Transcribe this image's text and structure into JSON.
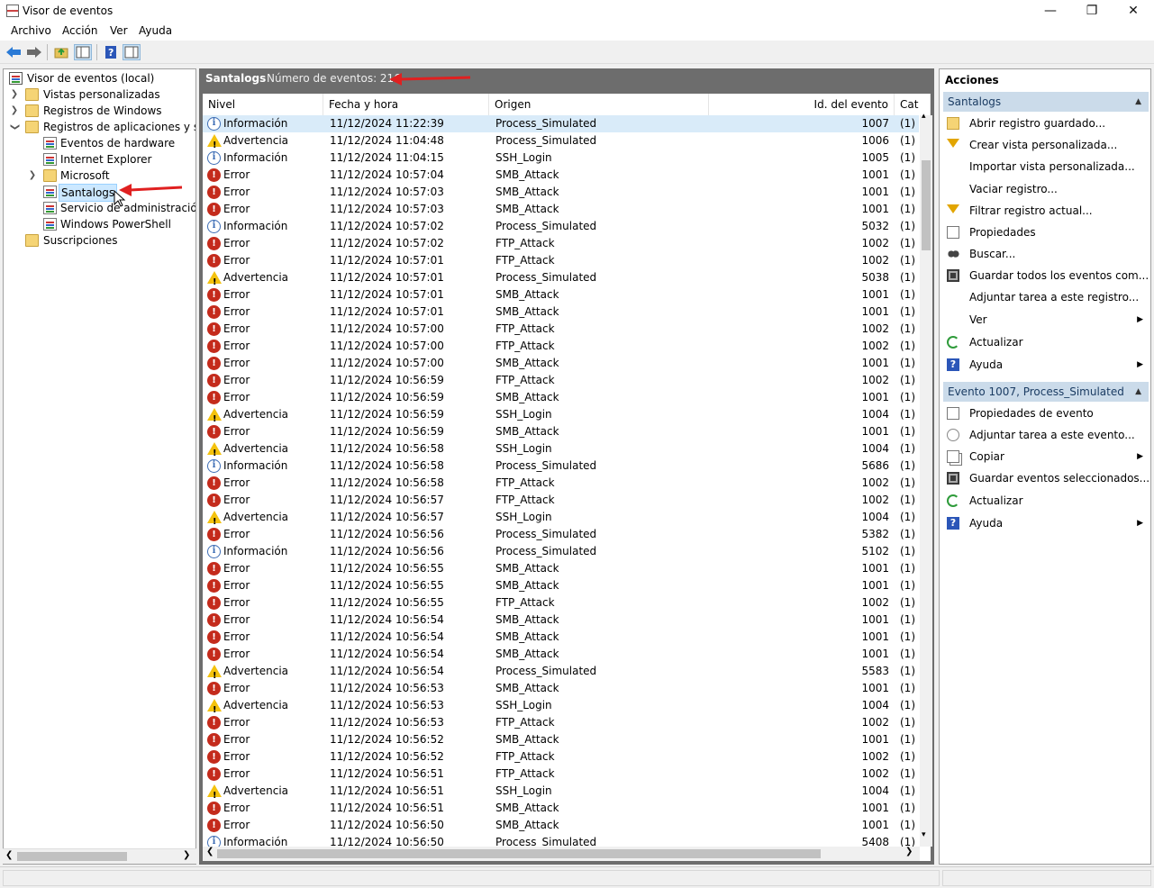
{
  "window": {
    "title": "Visor de eventos",
    "minimize": "—",
    "maximize": "❐",
    "close": "✕"
  },
  "menu": [
    "Archivo",
    "Acción",
    "Ver",
    "Ayuda"
  ],
  "tree": {
    "root": "Visor de eventos (local)",
    "custom_views": "Vistas personalizadas",
    "windows_logs": "Registros de Windows",
    "app_logs": "Registros de aplicaciones y servi",
    "hardware": "Eventos de hardware",
    "ie": "Internet Explorer",
    "microsoft": "Microsoft",
    "santalogs": "Santalogs",
    "admin_service": "Servicio de administración d",
    "powershell": "Windows PowerShell",
    "subscriptions": "Suscripciones"
  },
  "center": {
    "log_name": "Santalogs",
    "event_count": "Número de eventos: 216",
    "columns": [
      "Nivel",
      "Fecha y hora",
      "Origen",
      "Id. del evento",
      "Cat"
    ],
    "rows": [
      {
        "level": "Información",
        "type": "info",
        "date": "11/12/2024 11:22:39",
        "source": "Process_Simulated",
        "id": "1007",
        "cat": "(1)"
      },
      {
        "level": "Advertencia",
        "type": "warn",
        "date": "11/12/2024 11:04:48",
        "source": "Process_Simulated",
        "id": "1006",
        "cat": "(1)"
      },
      {
        "level": "Información",
        "type": "info",
        "date": "11/12/2024 11:04:15",
        "source": "SSH_Login",
        "id": "1005",
        "cat": "(1)"
      },
      {
        "level": "Error",
        "type": "err",
        "date": "11/12/2024 10:57:04",
        "source": "SMB_Attack",
        "id": "1001",
        "cat": "(1)"
      },
      {
        "level": "Error",
        "type": "err",
        "date": "11/12/2024 10:57:03",
        "source": "SMB_Attack",
        "id": "1001",
        "cat": "(1)"
      },
      {
        "level": "Error",
        "type": "err",
        "date": "11/12/2024 10:57:03",
        "source": "SMB_Attack",
        "id": "1001",
        "cat": "(1)"
      },
      {
        "level": "Información",
        "type": "info",
        "date": "11/12/2024 10:57:02",
        "source": "Process_Simulated",
        "id": "5032",
        "cat": "(1)"
      },
      {
        "level": "Error",
        "type": "err",
        "date": "11/12/2024 10:57:02",
        "source": "FTP_Attack",
        "id": "1002",
        "cat": "(1)"
      },
      {
        "level": "Error",
        "type": "err",
        "date": "11/12/2024 10:57:01",
        "source": "FTP_Attack",
        "id": "1002",
        "cat": "(1)"
      },
      {
        "level": "Advertencia",
        "type": "warn",
        "date": "11/12/2024 10:57:01",
        "source": "Process_Simulated",
        "id": "5038",
        "cat": "(1)"
      },
      {
        "level": "Error",
        "type": "err",
        "date": "11/12/2024 10:57:01",
        "source": "SMB_Attack",
        "id": "1001",
        "cat": "(1)"
      },
      {
        "level": "Error",
        "type": "err",
        "date": "11/12/2024 10:57:01",
        "source": "SMB_Attack",
        "id": "1001",
        "cat": "(1)"
      },
      {
        "level": "Error",
        "type": "err",
        "date": "11/12/2024 10:57:00",
        "source": "FTP_Attack",
        "id": "1002",
        "cat": "(1)"
      },
      {
        "level": "Error",
        "type": "err",
        "date": "11/12/2024 10:57:00",
        "source": "FTP_Attack",
        "id": "1002",
        "cat": "(1)"
      },
      {
        "level": "Error",
        "type": "err",
        "date": "11/12/2024 10:57:00",
        "source": "SMB_Attack",
        "id": "1001",
        "cat": "(1)"
      },
      {
        "level": "Error",
        "type": "err",
        "date": "11/12/2024 10:56:59",
        "source": "FTP_Attack",
        "id": "1002",
        "cat": "(1)"
      },
      {
        "level": "Error",
        "type": "err",
        "date": "11/12/2024 10:56:59",
        "source": "SMB_Attack",
        "id": "1001",
        "cat": "(1)"
      },
      {
        "level": "Advertencia",
        "type": "warn",
        "date": "11/12/2024 10:56:59",
        "source": "SSH_Login",
        "id": "1004",
        "cat": "(1)"
      },
      {
        "level": "Error",
        "type": "err",
        "date": "11/12/2024 10:56:59",
        "source": "SMB_Attack",
        "id": "1001",
        "cat": "(1)"
      },
      {
        "level": "Advertencia",
        "type": "warn",
        "date": "11/12/2024 10:56:58",
        "source": "SSH_Login",
        "id": "1004",
        "cat": "(1)"
      },
      {
        "level": "Información",
        "type": "info",
        "date": "11/12/2024 10:56:58",
        "source": "Process_Simulated",
        "id": "5686",
        "cat": "(1)"
      },
      {
        "level": "Error",
        "type": "err",
        "date": "11/12/2024 10:56:58",
        "source": "FTP_Attack",
        "id": "1002",
        "cat": "(1)"
      },
      {
        "level": "Error",
        "type": "err",
        "date": "11/12/2024 10:56:57",
        "source": "FTP_Attack",
        "id": "1002",
        "cat": "(1)"
      },
      {
        "level": "Advertencia",
        "type": "warn",
        "date": "11/12/2024 10:56:57",
        "source": "SSH_Login",
        "id": "1004",
        "cat": "(1)"
      },
      {
        "level": "Error",
        "type": "err",
        "date": "11/12/2024 10:56:56",
        "source": "Process_Simulated",
        "id": "5382",
        "cat": "(1)"
      },
      {
        "level": "Información",
        "type": "info",
        "date": "11/12/2024 10:56:56",
        "source": "Process_Simulated",
        "id": "5102",
        "cat": "(1)"
      },
      {
        "level": "Error",
        "type": "err",
        "date": "11/12/2024 10:56:55",
        "source": "SMB_Attack",
        "id": "1001",
        "cat": "(1)"
      },
      {
        "level": "Error",
        "type": "err",
        "date": "11/12/2024 10:56:55",
        "source": "SMB_Attack",
        "id": "1001",
        "cat": "(1)"
      },
      {
        "level": "Error",
        "type": "err",
        "date": "11/12/2024 10:56:55",
        "source": "FTP_Attack",
        "id": "1002",
        "cat": "(1)"
      },
      {
        "level": "Error",
        "type": "err",
        "date": "11/12/2024 10:56:54",
        "source": "SMB_Attack",
        "id": "1001",
        "cat": "(1)"
      },
      {
        "level": "Error",
        "type": "err",
        "date": "11/12/2024 10:56:54",
        "source": "SMB_Attack",
        "id": "1001",
        "cat": "(1)"
      },
      {
        "level": "Error",
        "type": "err",
        "date": "11/12/2024 10:56:54",
        "source": "SMB_Attack",
        "id": "1001",
        "cat": "(1)"
      },
      {
        "level": "Advertencia",
        "type": "warn",
        "date": "11/12/2024 10:56:54",
        "source": "Process_Simulated",
        "id": "5583",
        "cat": "(1)"
      },
      {
        "level": "Error",
        "type": "err",
        "date": "11/12/2024 10:56:53",
        "source": "SMB_Attack",
        "id": "1001",
        "cat": "(1)"
      },
      {
        "level": "Advertencia",
        "type": "warn",
        "date": "11/12/2024 10:56:53",
        "source": "SSH_Login",
        "id": "1004",
        "cat": "(1)"
      },
      {
        "level": "Error",
        "type": "err",
        "date": "11/12/2024 10:56:53",
        "source": "FTP_Attack",
        "id": "1002",
        "cat": "(1)"
      },
      {
        "level": "Error",
        "type": "err",
        "date": "11/12/2024 10:56:52",
        "source": "SMB_Attack",
        "id": "1001",
        "cat": "(1)"
      },
      {
        "level": "Error",
        "type": "err",
        "date": "11/12/2024 10:56:52",
        "source": "FTP_Attack",
        "id": "1002",
        "cat": "(1)"
      },
      {
        "level": "Error",
        "type": "err",
        "date": "11/12/2024 10:56:51",
        "source": "FTP_Attack",
        "id": "1002",
        "cat": "(1)"
      },
      {
        "level": "Advertencia",
        "type": "warn",
        "date": "11/12/2024 10:56:51",
        "source": "SSH_Login",
        "id": "1004",
        "cat": "(1)"
      },
      {
        "level": "Error",
        "type": "err",
        "date": "11/12/2024 10:56:51",
        "source": "SMB_Attack",
        "id": "1001",
        "cat": "(1)"
      },
      {
        "level": "Error",
        "type": "err",
        "date": "11/12/2024 10:56:50",
        "source": "SMB_Attack",
        "id": "1001",
        "cat": "(1)"
      },
      {
        "level": "Información",
        "type": "info",
        "date": "11/12/2024 10:56:50",
        "source": "Process_Simulated",
        "id": "5408",
        "cat": "(1)"
      }
    ]
  },
  "actions": {
    "title": "Acciones",
    "section1": "Santalogs",
    "items1": [
      {
        "label": "Abrir registro guardado...",
        "icon": "open-folder-icon",
        "submenu": false
      },
      {
        "label": "Crear vista personalizada...",
        "icon": "filter-icon",
        "submenu": false
      },
      {
        "label": "Importar vista personalizada...",
        "icon": "",
        "submenu": false
      },
      {
        "label": "Vaciar registro...",
        "icon": "",
        "submenu": false
      },
      {
        "label": "Filtrar registro actual...",
        "icon": "filter-icon",
        "submenu": false
      },
      {
        "label": "Propiedades",
        "icon": "properties-icon",
        "submenu": false
      },
      {
        "label": "Buscar...",
        "icon": "binoculars-icon",
        "submenu": false
      },
      {
        "label": "Guardar todos los eventos com...",
        "icon": "save-icon",
        "submenu": false
      },
      {
        "label": "Adjuntar tarea a este registro...",
        "icon": "",
        "submenu": false
      },
      {
        "label": "Ver",
        "icon": "",
        "submenu": true
      },
      {
        "label": "Actualizar",
        "icon": "refresh-icon",
        "submenu": false
      },
      {
        "label": "Ayuda",
        "icon": "help-icon",
        "submenu": true
      }
    ],
    "section2": "Evento 1007, Process_Simulated",
    "items2": [
      {
        "label": "Propiedades de evento",
        "icon": "properties-icon",
        "submenu": false
      },
      {
        "label": "Adjuntar tarea a este evento...",
        "icon": "task-icon",
        "submenu": false
      },
      {
        "label": "Copiar",
        "icon": "copy-icon",
        "submenu": true
      },
      {
        "label": "Guardar eventos seleccionados...",
        "icon": "save-icon",
        "submenu": false
      },
      {
        "label": "Actualizar",
        "icon": "refresh-icon",
        "submenu": false
      },
      {
        "label": "Ayuda",
        "icon": "help-icon",
        "submenu": true
      }
    ]
  }
}
